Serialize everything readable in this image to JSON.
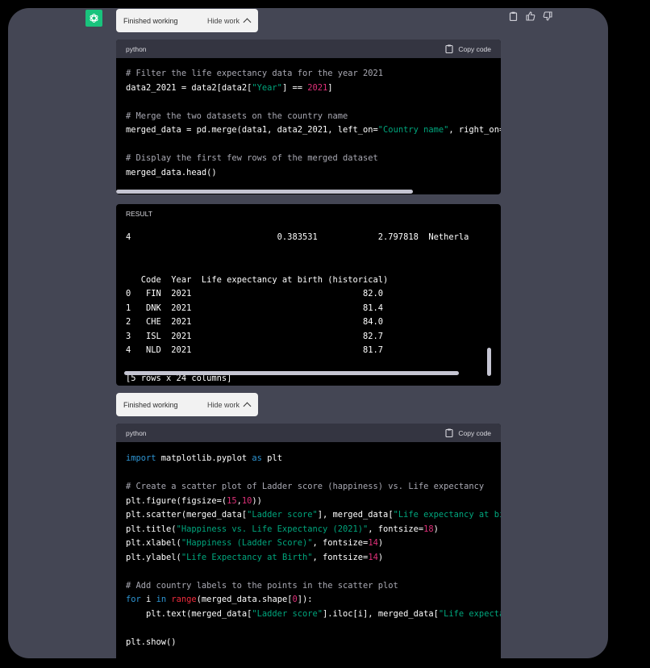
{
  "toolbar": {
    "finished_1": "Finished working",
    "hide_1": "Hide work",
    "finished_2": "Finished working",
    "hide_2": "Hide work"
  },
  "block1": {
    "lang": "python",
    "copy": "Copy code",
    "lines": [
      {
        "p": [
          [
            "cmt",
            "# Filter the life expectancy data for the year 2021"
          ]
        ]
      },
      {
        "p": [
          [
            "",
            "data2_2021 = data2[data2["
          ],
          [
            "str",
            "\"Year\""
          ],
          [
            "",
            "] == "
          ],
          [
            "num",
            "2021"
          ],
          [
            "",
            "]"
          ]
        ]
      },
      {
        "p": [
          [
            "",
            ""
          ]
        ]
      },
      {
        "p": [
          [
            "cmt",
            "# Merge the two datasets on the country name"
          ]
        ]
      },
      {
        "p": [
          [
            "",
            "merged_data = pd.merge(data1, data2_2021, left_on="
          ],
          [
            "str",
            "\"Country name\""
          ],
          [
            "",
            ", right_on="
          ],
          [
            "str",
            "\""
          ]
        ]
      },
      {
        "p": [
          [
            "",
            ""
          ]
        ]
      },
      {
        "p": [
          [
            "cmt",
            "# Display the first few rows of the merged dataset"
          ]
        ]
      },
      {
        "p": [
          [
            "",
            "merged_data.head()"
          ]
        ]
      }
    ]
  },
  "result": {
    "label": "RESULT",
    "lines": [
      "4                             0.383531            2.797818  Netherla",
      "",
      "",
      "   Code  Year  Life expectancy at birth (historical)",
      "0   FIN  2021                                  82.0",
      "1   DNK  2021                                  81.4",
      "2   CHE  2021                                  84.0",
      "3   ISL  2021                                  82.7",
      "4   NLD  2021                                  81.7",
      "",
      "[5 rows x 24 columns]"
    ]
  },
  "block2": {
    "lang": "python",
    "copy": "Copy code",
    "lines": [
      {
        "p": [
          [
            "kw",
            "import"
          ],
          [
            "",
            " matplotlib.pyplot "
          ],
          [
            "kw",
            "as"
          ],
          [
            "",
            " plt"
          ]
        ]
      },
      {
        "p": [
          [
            "",
            ""
          ]
        ]
      },
      {
        "p": [
          [
            "cmt",
            "# Create a scatter plot of Ladder score (happiness) vs. Life expectancy"
          ]
        ]
      },
      {
        "p": [
          [
            "",
            "plt.figure(figsize=("
          ],
          [
            "num",
            "15"
          ],
          [
            "",
            ","
          ],
          [
            "num",
            "10"
          ],
          [
            "",
            "))"
          ]
        ]
      },
      {
        "p": [
          [
            "",
            "plt.scatter(merged_data["
          ],
          [
            "str",
            "\"Ladder score\""
          ],
          [
            "",
            "], merged_data["
          ],
          [
            "str",
            "\"Life expectancy at bir"
          ]
        ]
      },
      {
        "p": [
          [
            "",
            "plt.title("
          ],
          [
            "str",
            "\"Happiness vs. Life Expectancy (2021)\""
          ],
          [
            "",
            ", fontsize="
          ],
          [
            "num",
            "18"
          ],
          [
            "",
            ")"
          ]
        ]
      },
      {
        "p": [
          [
            "",
            "plt.xlabel("
          ],
          [
            "str",
            "\"Happiness (Ladder Score)\""
          ],
          [
            "",
            ", fontsize="
          ],
          [
            "num",
            "14"
          ],
          [
            "",
            ")"
          ]
        ]
      },
      {
        "p": [
          [
            "",
            "plt.ylabel("
          ],
          [
            "str",
            "\"Life Expectancy at Birth\""
          ],
          [
            "",
            ", fontsize="
          ],
          [
            "num",
            "14"
          ],
          [
            "",
            ")"
          ]
        ]
      },
      {
        "p": [
          [
            "",
            ""
          ]
        ]
      },
      {
        "p": [
          [
            "cmt",
            "# Add country labels to the points in the scatter plot"
          ]
        ]
      },
      {
        "p": [
          [
            "kw",
            "for"
          ],
          [
            "",
            " i "
          ],
          [
            "kw",
            "in"
          ],
          [
            "",
            " "
          ],
          [
            "fn",
            "range"
          ],
          [
            "",
            "(merged_data.shape["
          ],
          [
            "num",
            "0"
          ],
          [
            "",
            "]):"
          ]
        ]
      },
      {
        "p": [
          [
            "",
            "    plt.text(merged_data["
          ],
          [
            "str",
            "\"Ladder score\""
          ],
          [
            "",
            "].iloc[i], merged_data["
          ],
          [
            "str",
            "\"Life expectan"
          ]
        ]
      },
      {
        "p": [
          [
            "",
            ""
          ]
        ]
      },
      {
        "p": [
          [
            "",
            "plt.show()"
          ]
        ]
      }
    ]
  }
}
